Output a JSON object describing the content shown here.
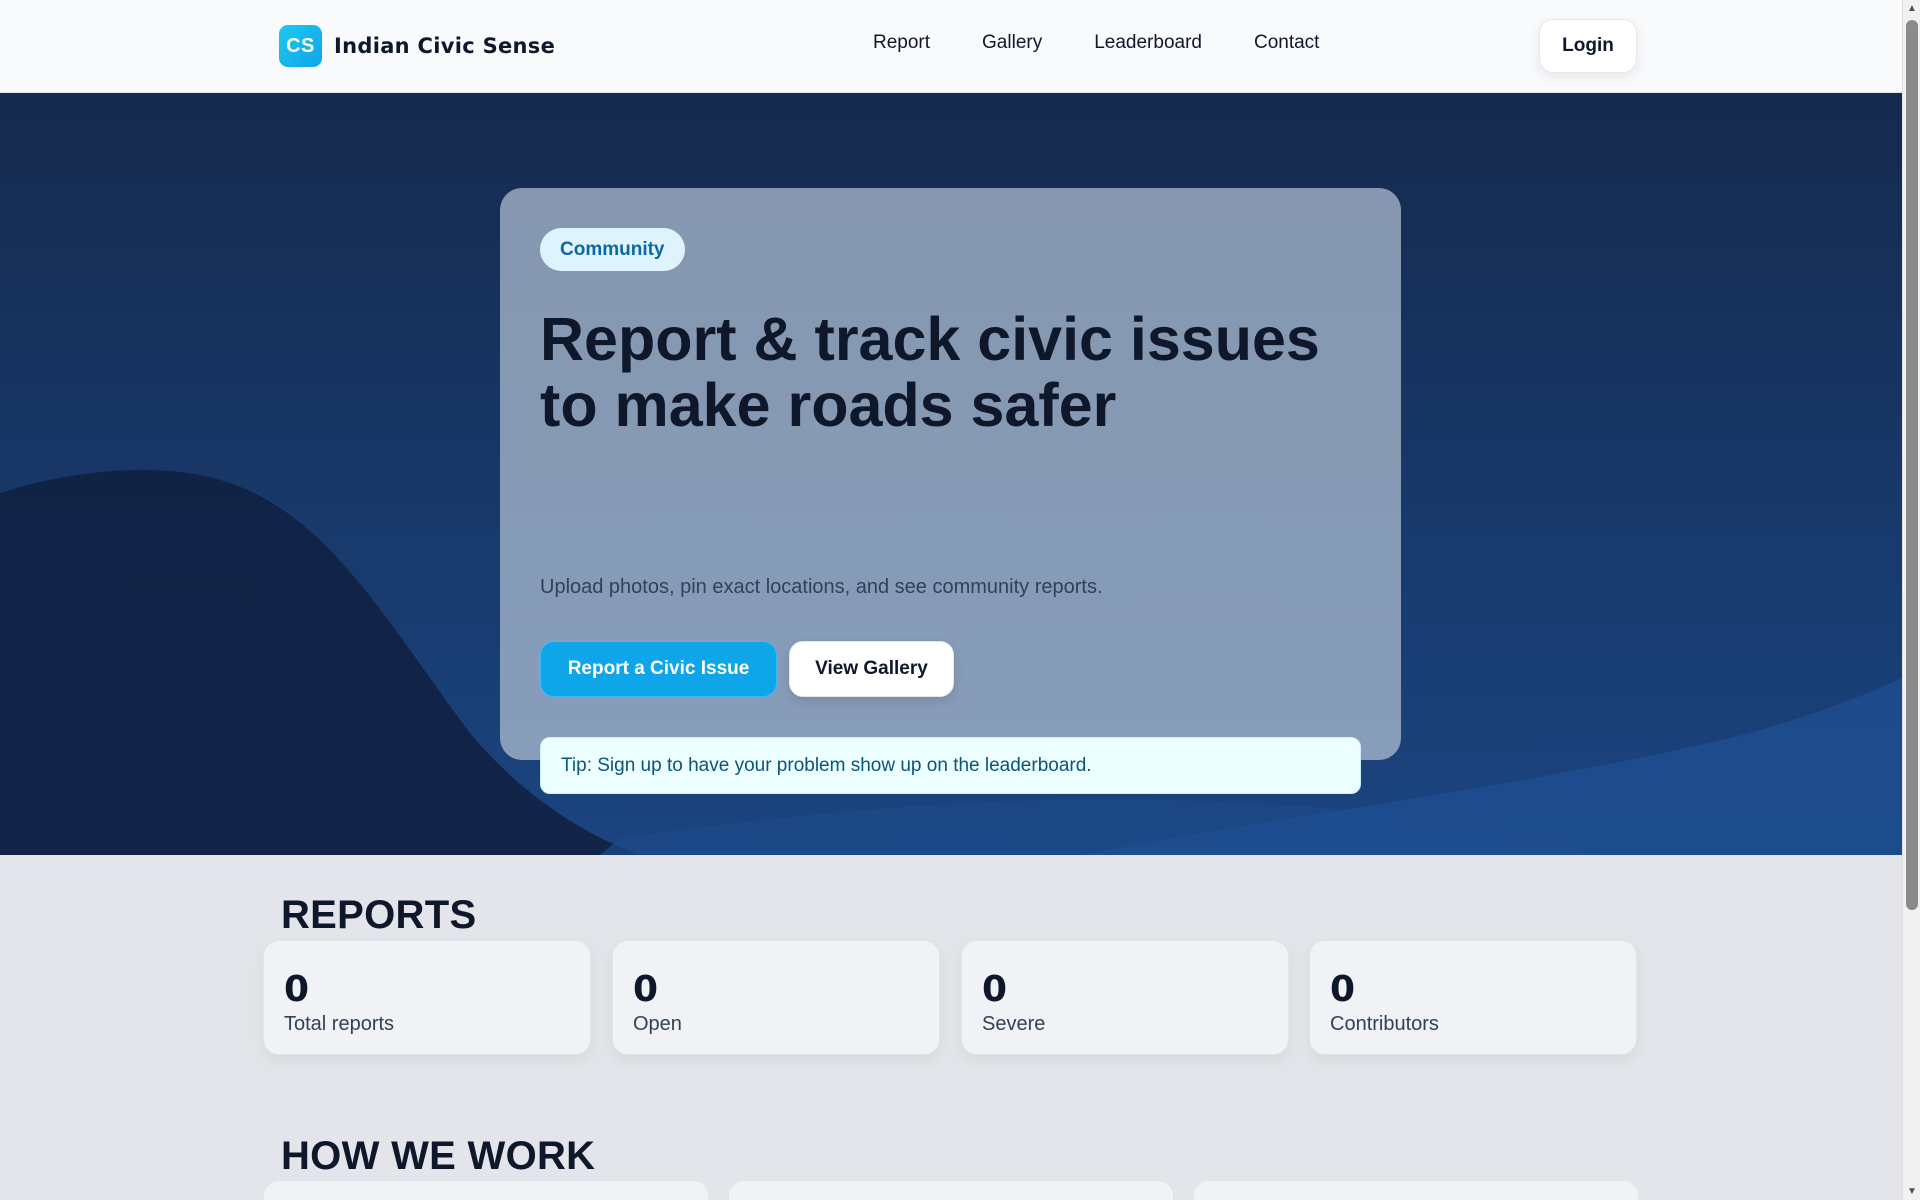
{
  "header": {
    "logo_text": "CS",
    "brand_name": "Indian Civic Sense",
    "nav": [
      {
        "label": "Report"
      },
      {
        "label": "Gallery"
      },
      {
        "label": "Leaderboard"
      },
      {
        "label": "Contact"
      }
    ],
    "login_label": "Login"
  },
  "hero": {
    "badge": "Community",
    "title": "Report & track civic issues to make roads safer",
    "subtitle": "Upload photos, pin exact locations, and see community reports.",
    "primary_button": "Report a Civic Issue",
    "secondary_button": "View Gallery",
    "tip": "Tip: Sign up to have your problem show up on the leaderboard."
  },
  "reports": {
    "title": "REPORTS",
    "stats": [
      {
        "value": "0",
        "label": "Total reports"
      },
      {
        "value": "0",
        "label": "Open"
      },
      {
        "value": "0",
        "label": "Severe"
      },
      {
        "value": "0",
        "label": "Contributors"
      }
    ]
  },
  "how_we_work": {
    "title": "HOW WE WORK"
  },
  "colors": {
    "accent": "#0ea5e9",
    "hero_bg": "#183a6d",
    "text": "#0f172a"
  }
}
